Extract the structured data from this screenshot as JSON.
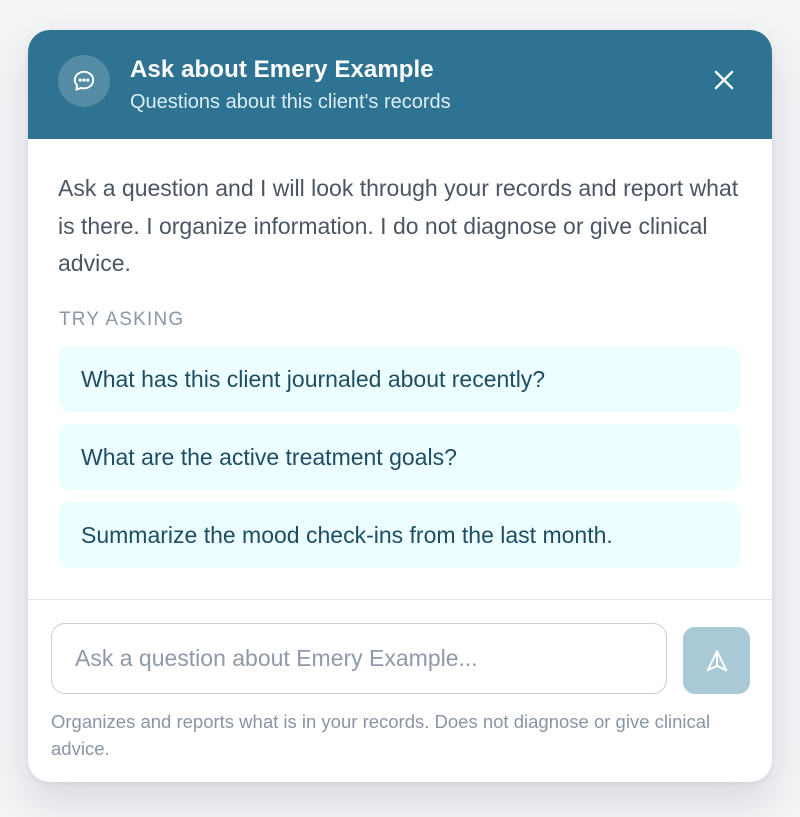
{
  "header": {
    "title": "Ask about Emery Example",
    "subtitle": "Questions about this client's records",
    "icon": "chat-bubble-icon",
    "close_icon": "close-icon",
    "background_color": "#2e7391"
  },
  "intro_text": "Ask a question and I will look through your records and report what is there. I organize information. I do not diagnose or give clinical advice.",
  "suggestions": {
    "label": "TRY ASKING",
    "items": [
      "What has this client journaled about recently?",
      "What are the active treatment goals?",
      "Summarize the mood check-ins from the last month."
    ],
    "background_color": "#ecfeff"
  },
  "composer": {
    "value": "",
    "placeholder": "Ask a question about Emery Example...",
    "send_icon": "send-icon",
    "footnote": "Organizes and reports what is in your records. Does not diagnose or give clinical advice."
  }
}
